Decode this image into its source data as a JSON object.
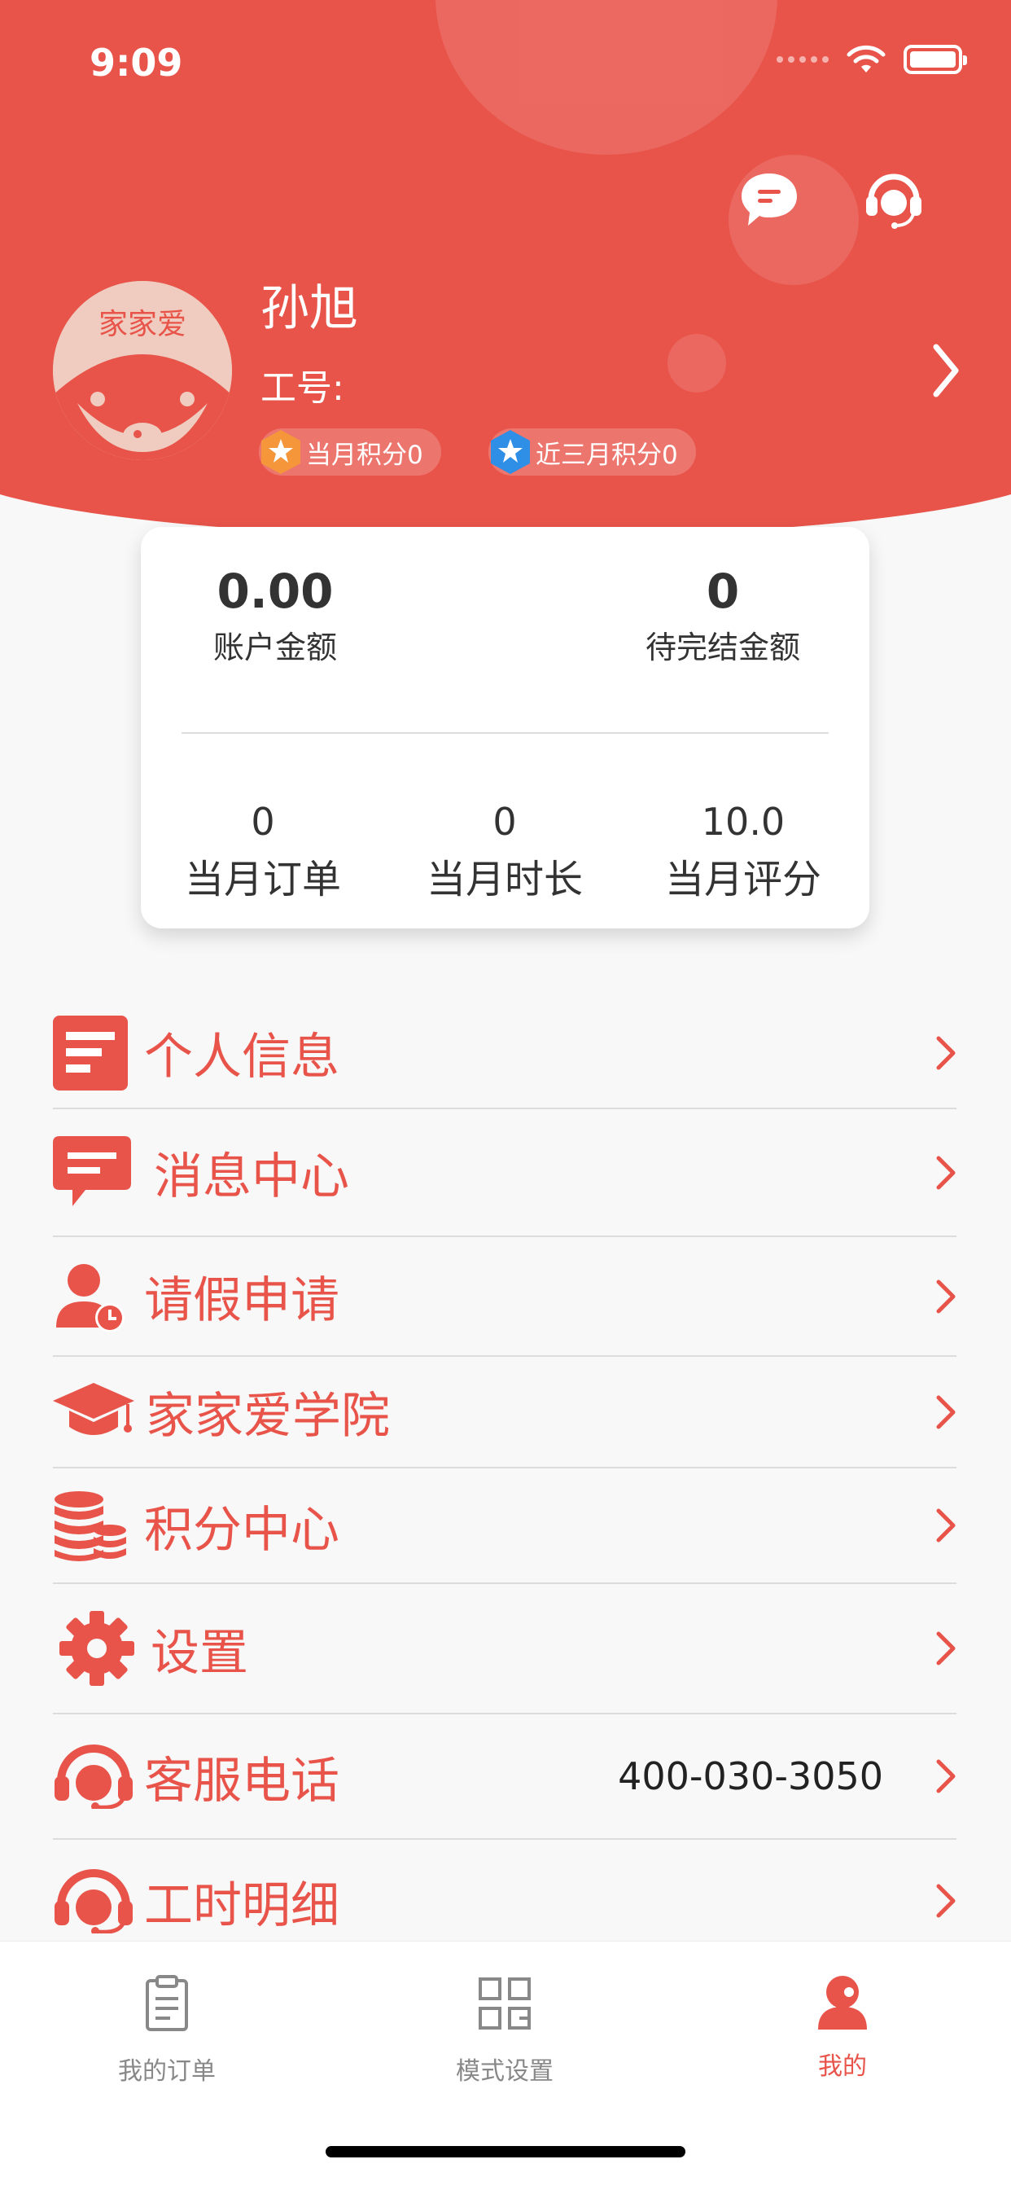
{
  "status": {
    "time": "9:09"
  },
  "profile": {
    "name": "孙旭",
    "work_no_label": "工号:",
    "avatar_text": "家家爱",
    "badges": [
      {
        "label": "当月积分0",
        "color": "#f5963a"
      },
      {
        "label": "近三月积分0",
        "color": "#2f8ee6"
      }
    ]
  },
  "summary": {
    "account_amount": "0.00",
    "account_amount_label": "账户金额",
    "pending_amount": "0",
    "pending_amount_label": "待完结金额",
    "stats": [
      {
        "value": "0",
        "label": "当月订单"
      },
      {
        "value": "0",
        "label": "当月时长"
      },
      {
        "value": "10.0",
        "label": "当月评分"
      }
    ]
  },
  "menu": [
    {
      "label": "个人信息",
      "icon": "id-card-icon"
    },
    {
      "label": "消息中心",
      "icon": "message-icon"
    },
    {
      "label": "请假申请",
      "icon": "leave-request-icon"
    },
    {
      "label": "家家爱学院",
      "icon": "graduation-cap-icon"
    },
    {
      "label": "积分中心",
      "icon": "coins-icon"
    },
    {
      "label": "设置",
      "icon": "gear-icon"
    },
    {
      "label": "客服电话",
      "icon": "headset-icon",
      "value": "400-030-3050"
    },
    {
      "label": "工时明细",
      "icon": "headset-icon"
    }
  ],
  "tabs": [
    {
      "label": "我的订单",
      "icon": "clipboard-icon"
    },
    {
      "label": "模式设置",
      "icon": "grid-icon"
    },
    {
      "label": "我的",
      "icon": "person-icon",
      "active": true
    }
  ],
  "colors": {
    "accent": "#e8544a",
    "tab_inactive": "#888888"
  }
}
